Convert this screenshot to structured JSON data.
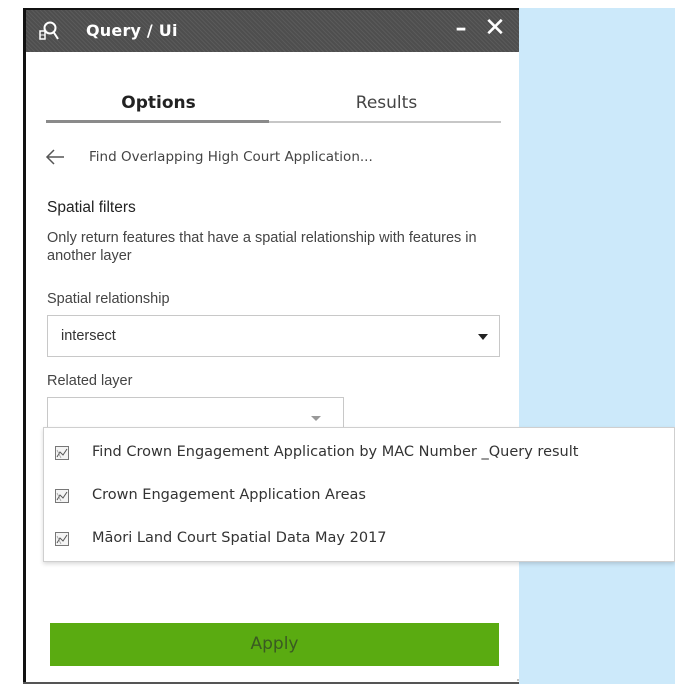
{
  "window": {
    "title": "Query / Ui",
    "app_icon": "query-widget-icon",
    "minimize_icon": "minimize-icon",
    "close_icon": "close-icon",
    "minimize_glyph": "–",
    "close_glyph": "✕"
  },
  "tabs": [
    {
      "label": "Options",
      "active": true
    },
    {
      "label": "Results",
      "active": false
    }
  ],
  "back": {
    "icon": "back-arrow-icon",
    "label": "Find Overlapping High Court Application..."
  },
  "spatial_filters": {
    "title": "Spatial filters",
    "description": "Only return features that have a spatial relationship with features in another layer",
    "relationship_label": "Spatial relationship",
    "relationship_value": "intersect",
    "related_layer_label": "Related layer",
    "related_layer_value": ""
  },
  "related_layer_options": [
    {
      "label": "Find Crown Engagement Application by MAC Number _Query result",
      "icon": "layer-icon"
    },
    {
      "label": "Crown Engagement Application Areas",
      "icon": "layer-icon"
    },
    {
      "label": "Māori Land Court Spatial Data May 2017",
      "icon": "layer-icon"
    }
  ],
  "apply_button": {
    "label": "Apply"
  },
  "colors": {
    "titlebar": "#4e4e4e",
    "apply": "#5aab11",
    "map_background": "#cce9fa"
  }
}
